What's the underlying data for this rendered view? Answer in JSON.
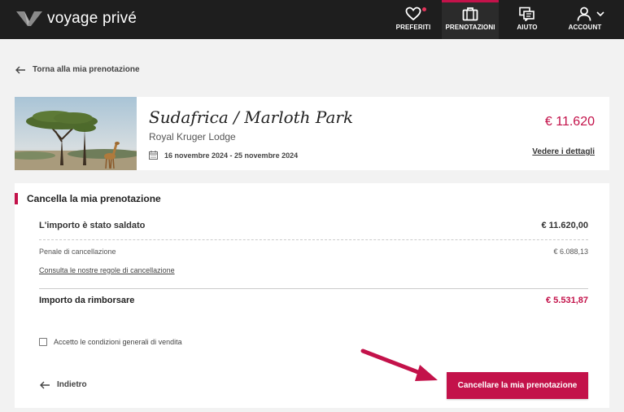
{
  "header": {
    "logo_text": "voyage privé",
    "nav": [
      {
        "label": "PREFERITI",
        "icon": "heart-icon"
      },
      {
        "label": "PRENOTAZIONI",
        "icon": "suitcase-icon"
      },
      {
        "label": "AIUTO",
        "icon": "help-chat-icon"
      },
      {
        "label": "ACCOUNT",
        "icon": "user-icon"
      }
    ]
  },
  "back_link": "Torna alla mia prenotazione",
  "trip": {
    "title": "Sudafrica / Marloth Park",
    "hotel": "Royal Kruger Lodge",
    "dates": "16 novembre 2024 - 25 novembre 2024",
    "price": "€ 11.620",
    "details_link": "Vedere i dettagli"
  },
  "cancel": {
    "title": "Cancella la mia prenotazione",
    "paid_label": "L'importo è stato saldato",
    "paid_amount": "€ 11.620,00",
    "penalty_label": "Penale di cancellazione",
    "penalty_amount": "€ 6.088,13",
    "rules_link": "Consulta le nostre regole di cancellazione",
    "refund_label": "Importo da rimborsare",
    "refund_amount": "€ 5.531,87",
    "terms_label": "Accetto le condizioni generali di vendita",
    "terms_checked": false,
    "back_label": "Indietro",
    "submit_label": "Cancellare la mia prenotazione"
  },
  "colors": {
    "accent": "#c3124a",
    "header_bg": "#1e1e1e",
    "page_bg": "#f2f2f2"
  }
}
